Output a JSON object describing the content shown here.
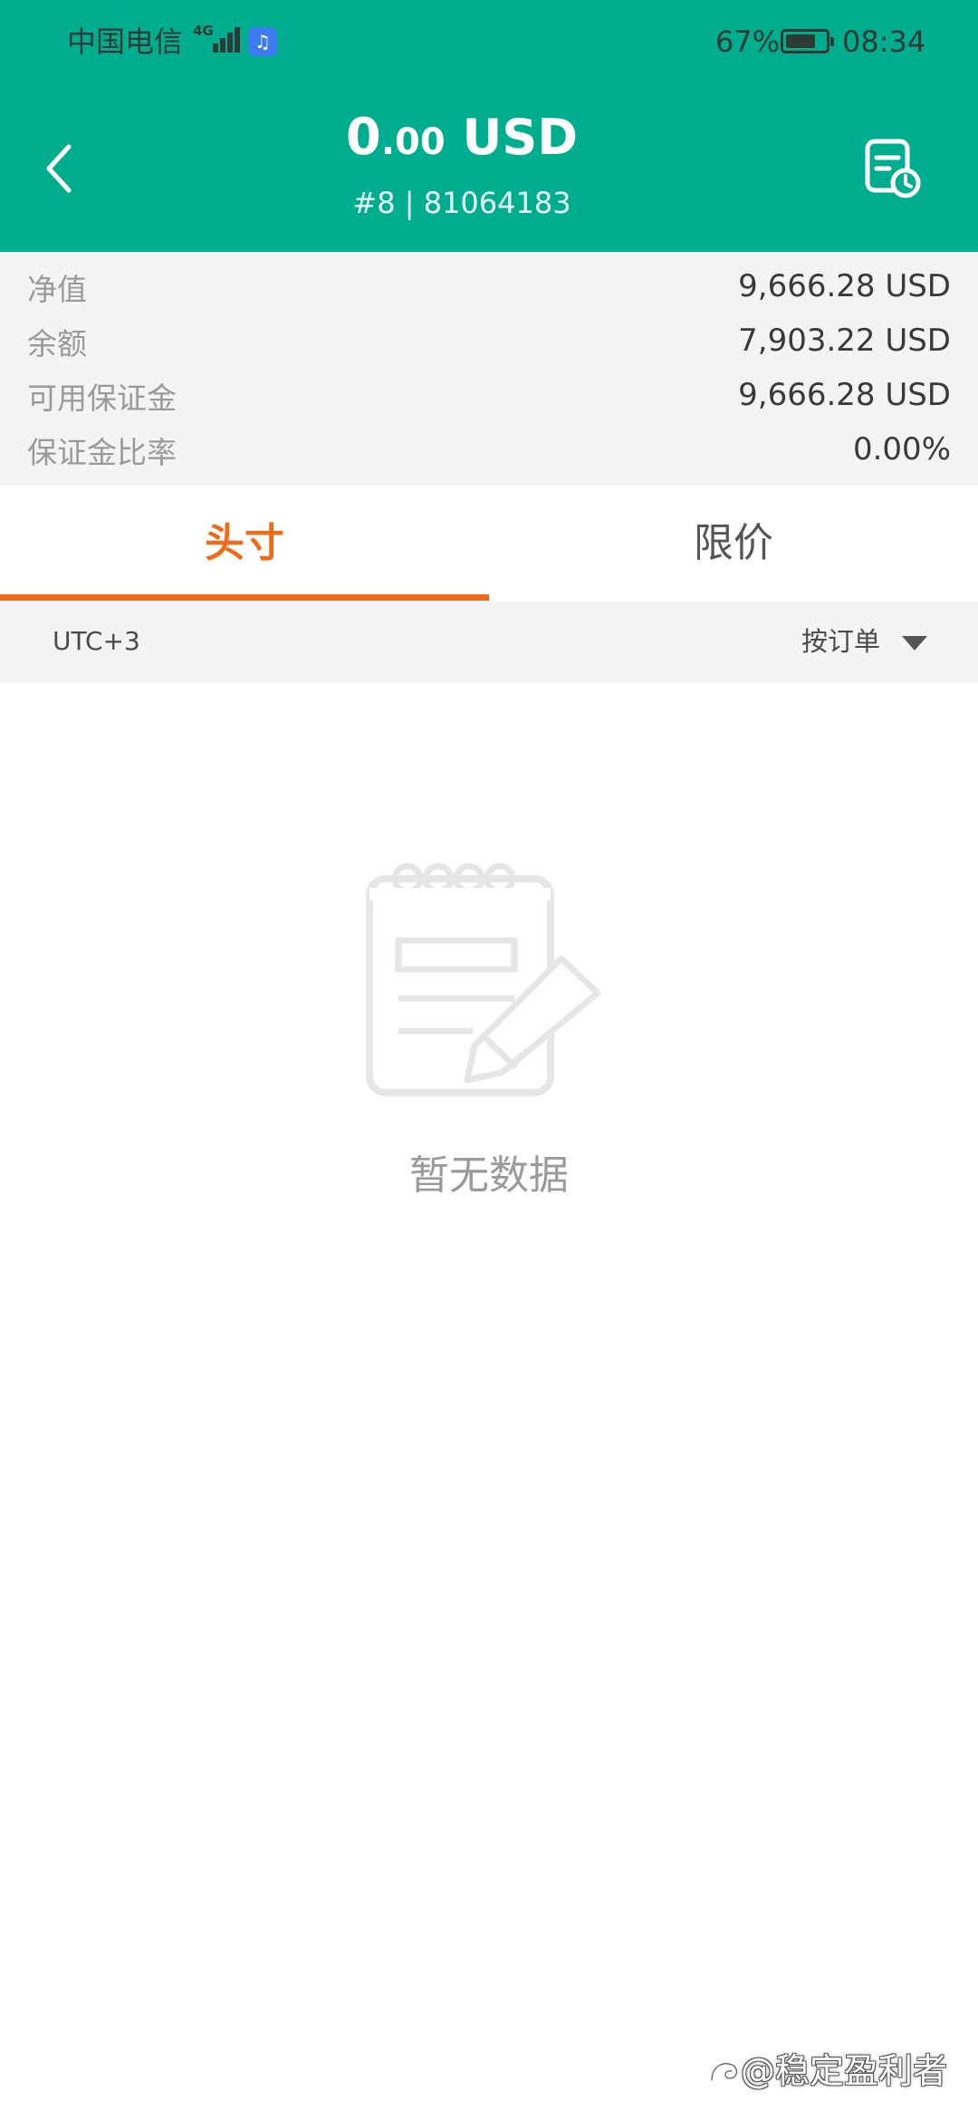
{
  "status_bar": {
    "carrier": "中国电信",
    "network_type": "4G",
    "battery_percent": "67%",
    "time": "08:34"
  },
  "header": {
    "balance_integer": "0",
    "balance_decimal": ".00",
    "currency": " USD",
    "account_line": "#8 | 81064183",
    "back_icon": "chevron-left-icon",
    "history_icon": "order-history-icon"
  },
  "summary": [
    {
      "label": "净值",
      "value": "9,666.28 USD"
    },
    {
      "label": "余额",
      "value": "7,903.22 USD"
    },
    {
      "label": "可用保证金",
      "value": "9,666.28 USD"
    },
    {
      "label": "保证金比率",
      "value": "0.00%"
    }
  ],
  "tabs": [
    {
      "label": "头寸",
      "active": true
    },
    {
      "label": "限价",
      "active": false
    }
  ],
  "filter": {
    "timezone": "UTC+3",
    "sort_label": "按订单"
  },
  "empty_state": {
    "icon": "notepad-pencil-icon",
    "text": "暂无数据"
  },
  "watermark": {
    "text": "@稳定盈利者"
  },
  "colors": {
    "primary": "#00ae8f",
    "accent": "#ee6b17",
    "panel_background": "#f3f4f6"
  }
}
